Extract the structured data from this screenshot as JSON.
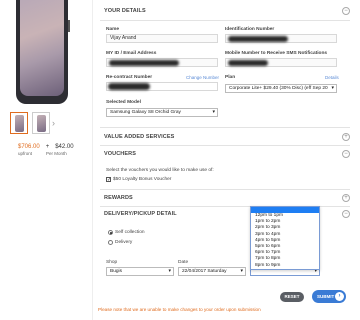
{
  "product": {
    "prices": {
      "upfront": "$706.00",
      "plus": "+",
      "monthly": "$42.00"
    },
    "price_labels": {
      "upfront": "upfront",
      "monthly": "Per Month"
    },
    "thumb_nav": "›"
  },
  "your_details": {
    "heading": "YOUR DETAILS",
    "toggle": "−",
    "name_label": "Name",
    "name_value": "Vijay Anand",
    "id_label": "Identification Number",
    "myid_label": "MY ID / Email Address",
    "mobile_label": "Mobile Number to Receive SMS Notifications",
    "recontract_label": "Re-contract Number",
    "change_number": "Change Number",
    "plan_label": "Plan",
    "details_link": "Details",
    "plan_value": "Corporate Lite+ $29.40 (30% Disc) (eff Sep 20",
    "model_label": "Selected Model",
    "model_value": "Samsung Galaxy S8 Orchid Gray"
  },
  "value_added": {
    "heading": "VALUE ADDED SERVICES",
    "toggle": "+"
  },
  "vouchers": {
    "heading": "VOUCHERS",
    "toggle": "−",
    "intro": "Select the vouchers you would like to make use of:",
    "item": "$50 Loyalty Bonus Voucher",
    "checked": "✓"
  },
  "rewards": {
    "heading": "REWARDS",
    "toggle": "+"
  },
  "delivery": {
    "heading": "DELIVERY/PICKUP DETAIL",
    "toggle": "−",
    "self_collection": "Self collection",
    "delivery": "Delivery",
    "shop_label": "Shop",
    "shop_value": "Bugis",
    "date_label": "Date",
    "date_value": "22/04/2017  Saturday",
    "time_value": "",
    "caret": "▾"
  },
  "time_dropdown": {
    "options": [
      "12pm to 1pm",
      "1pm to 2pm",
      "2pm to 3pm",
      "3pm to 4pm",
      "4pm to 5pm",
      "5pm to 6pm",
      "6pm to 7pm",
      "7pm to 8pm",
      "8pm to 9pm"
    ]
  },
  "actions": {
    "reset": "RESET",
    "submit": "SUBMIT",
    "submit_arrow": "›"
  },
  "note": "Please note that we are unable to make changes to your order upon submission",
  "colors": {
    "accent": "#e06c1f",
    "primary": "#3a7bd5",
    "highlight": "#1e7ef3"
  }
}
